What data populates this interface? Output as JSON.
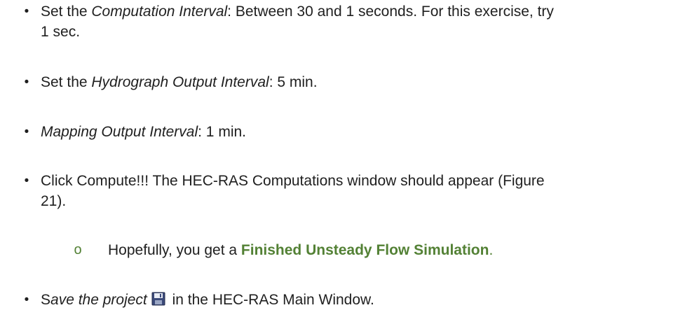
{
  "bullets": {
    "symbol": "•",
    "sub_symbol": "o"
  },
  "items": [
    {
      "prefix": "Set the ",
      "emph": "Computation Interval",
      "rest_line1": ": Between 30 and 1 seconds. For this exercise, try",
      "rest_line2": "1 sec."
    },
    {
      "prefix": "Set the ",
      "emph": "Hydrograph Output Interval",
      "rest": ": 5 min."
    },
    {
      "emph": "Mapping Output Interval",
      "rest": ": 1 min."
    },
    {
      "line1": "Click Compute!!! The HEC-RAS Computations window should appear (Figure",
      "line2": "21)."
    },
    {
      "sub": true,
      "prefix": "Hopefully, you get a ",
      "highlight": "Finished Unsteady Flow Simulation",
      "suffix": "."
    },
    {
      "lead": "S",
      "emph": "ave the project",
      "icon": "floppy-disk-save-icon",
      "rest": " in the HEC-RAS Main Window."
    }
  ],
  "colors": {
    "text": "#1f1f1f",
    "accent_green": "#538135"
  }
}
